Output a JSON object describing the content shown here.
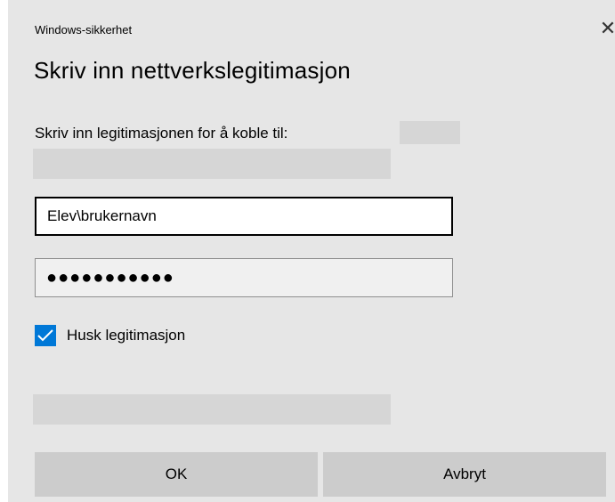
{
  "window": {
    "title": "Windows-sikkerhet",
    "close_icon": "close-icon"
  },
  "dialog": {
    "heading": "Skriv inn nettverkslegitimasjon",
    "prompt": "Skriv inn legitimasjonen for å koble til:"
  },
  "form": {
    "username_value": "Elev\\brukernavn",
    "password_value": "●●●●●●●●●●●",
    "remember_label": "Husk legitimasjon",
    "remember_checked": true
  },
  "buttons": {
    "ok_label": "OK",
    "cancel_label": "Avbryt"
  },
  "colors": {
    "dialog_bg": "#e6e6e6",
    "accent": "#0078d7",
    "button_bg": "#cccccc"
  }
}
